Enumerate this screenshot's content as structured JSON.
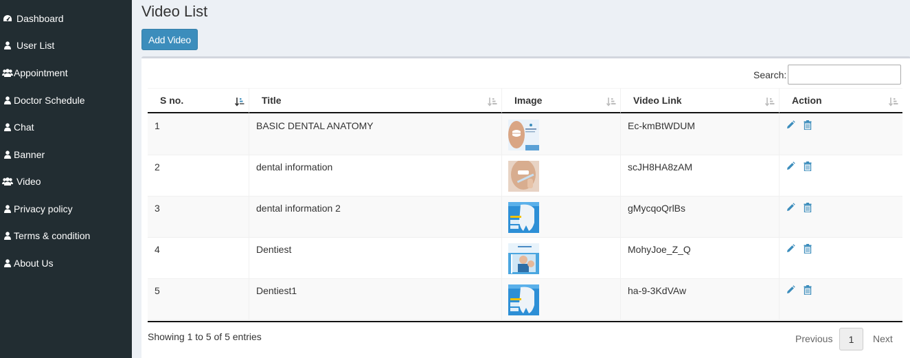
{
  "sidebar": {
    "items": [
      {
        "label": "Dashboard",
        "icon": "dashboard-icon"
      },
      {
        "label": "User List",
        "icon": "user-icon"
      },
      {
        "label": "Appointment",
        "icon": "users-icon"
      },
      {
        "label": "Doctor Schedule",
        "icon": "user-icon"
      },
      {
        "label": "Chat",
        "icon": "user-icon"
      },
      {
        "label": "Banner",
        "icon": "user-icon"
      },
      {
        "label": "Video",
        "icon": "users-icon"
      },
      {
        "label": "Privacy policy",
        "icon": "user-icon"
      },
      {
        "label": "Terms & condition",
        "icon": "user-icon"
      },
      {
        "label": "About Us",
        "icon": "user-icon"
      }
    ]
  },
  "page": {
    "title": "Video List",
    "add_button": "Add Video"
  },
  "search": {
    "label": "Search:",
    "value": ""
  },
  "table": {
    "columns": [
      "S no.",
      "Title",
      "Image",
      "Video Link",
      "Action"
    ],
    "rows": [
      {
        "sno": "1",
        "title": "BASIC DENTAL ANATOMY",
        "image": "teeth-smile-thumbnail",
        "link": "Ec-kmBtWDUM"
      },
      {
        "sno": "2",
        "title": "dental information",
        "image": "toothbrush-thumbnail",
        "link": "scJH8HA8zAM"
      },
      {
        "sno": "3",
        "title": "dental information 2",
        "image": "tooth-banner-thumbnail",
        "link": "gMycqoQrlBs"
      },
      {
        "sno": "4",
        "title": "Dentiest",
        "image": "dentist-thumbnail",
        "link": "MohyJoe_Z_Q"
      },
      {
        "sno": "5",
        "title": "Dentiest1",
        "image": "tooth-banner-thumbnail",
        "link": "ha-9-3KdVAw"
      }
    ]
  },
  "footer": {
    "info": "Showing 1 to 5 of 5 entries",
    "previous": "Previous",
    "current_page": "1",
    "next": "Next"
  },
  "colors": {
    "sidebar_bg": "#222d32",
    "primary": "#3c8dbc",
    "content_bg": "#ecf0f5"
  }
}
